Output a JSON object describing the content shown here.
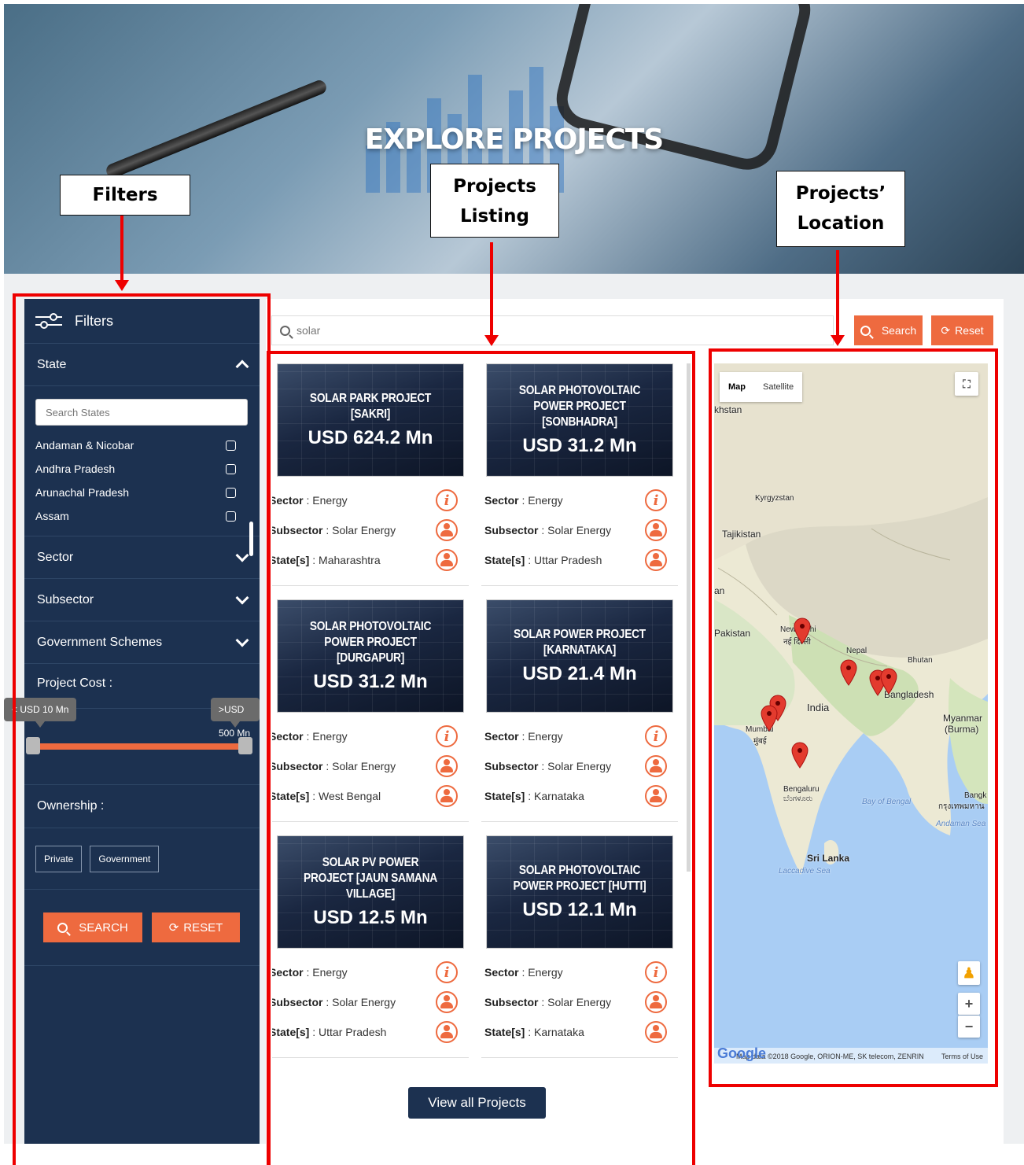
{
  "hero": {
    "title": "EXPLORE PROJECTS"
  },
  "callouts": {
    "filters": "Filters",
    "listing_line1": "Projects",
    "listing_line2": "Listing",
    "location_line1": "Projects’",
    "location_line2": "Location"
  },
  "sidebar": {
    "title": "Filters",
    "state": {
      "label": "State",
      "search_placeholder": "Search States",
      "items": [
        "Andaman & Nicobar",
        "Andhra Pradesh",
        "Arunachal Pradesh",
        "Assam"
      ]
    },
    "sector_label": "Sector",
    "subsector_label": "Subsector",
    "schemes_label": "Government Schemes",
    "cost": {
      "label": "Project Cost :",
      "min_label": "< USD 10 Mn",
      "max_label": ">USD 500 Mn"
    },
    "ownership": {
      "label": "Ownership :",
      "private": "Private",
      "government": "Government"
    },
    "search_btn": "SEARCH",
    "reset_btn": "RESET"
  },
  "search": {
    "placeholder": "solar",
    "search_btn": "Search",
    "reset_btn": "Reset"
  },
  "field_labels": {
    "sector": "Sector",
    "subsector": "Subsector",
    "states": "State[s]",
    "sep": " : "
  },
  "projects": [
    {
      "title": "SOLAR PARK PROJECT [SAKRI]",
      "cost": "USD 624.2 Mn",
      "sector": "Energy",
      "subsector": "Solar Energy",
      "states": "Maharashtra"
    },
    {
      "title": "SOLAR PHOTOVOLTAIC POWER PROJECT [SONBHADRA]",
      "cost": "USD 31.2 Mn",
      "sector": "Energy",
      "subsector": "Solar Energy",
      "states": "Uttar Pradesh"
    },
    {
      "title": "SOLAR PHOTOVOLTAIC POWER PROJECT [DURGAPUR]",
      "cost": "USD 31.2 Mn",
      "sector": "Energy",
      "subsector": "Solar Energy",
      "states": "West Bengal"
    },
    {
      "title": "SOLAR POWER PROJECT [KARNATAKA]",
      "cost": "USD 21.4 Mn",
      "sector": "Energy",
      "subsector": "Solar Energy",
      "states": "Karnataka"
    },
    {
      "title": "SOLAR PV POWER PROJECT [JAUN SAMANA VILLAGE]",
      "cost": "USD 12.5 Mn",
      "sector": "Energy",
      "subsector": "Solar Energy",
      "states": "Uttar Pradesh"
    },
    {
      "title": "SOLAR PHOTOVOLTAIC POWER PROJECT [HUTTI]",
      "cost": "USD 12.1 Mn",
      "sector": "Energy",
      "subsector": "Solar Energy",
      "states": "Karnataka"
    }
  ],
  "view_all": "View all Projects",
  "map": {
    "type_map": "Map",
    "type_satellite": "Satellite",
    "labels": {
      "kazakhstan": "khstan",
      "kyrgyzstan": "Kyrgyzstan",
      "tajikistan": "Tajikistan",
      "afghanistan": "an",
      "pakistan": "Pakistan",
      "new_delhi": "New Delhi",
      "new_delhi_local": "नई दिल्ली",
      "nepal": "Nepal",
      "bhutan": "Bhutan",
      "bangladesh": "Bangladesh",
      "india": "India",
      "myanmar": "Myanmar",
      "burma": "(Burma)",
      "mumbai": "Mumbai",
      "mumbai_local": "मुंबई",
      "bengaluru": "Bengaluru",
      "bengaluru_local": "ಬೆಂಗಳೂರು",
      "bay_of_bengal": "Bay of Bengal",
      "bangkok": "Bangk",
      "bangkok_local": "กรุงเทพมหาน",
      "andaman_sea": "Andaman Sea",
      "sri_lanka": "Sri Lanka",
      "laccadive_sea": "Laccadive Sea"
    },
    "attribution": "Map data ©2018 Google, ORION-ME, SK telecom, ZENRIN",
    "terms": "Terms of Use",
    "google": "Google"
  }
}
